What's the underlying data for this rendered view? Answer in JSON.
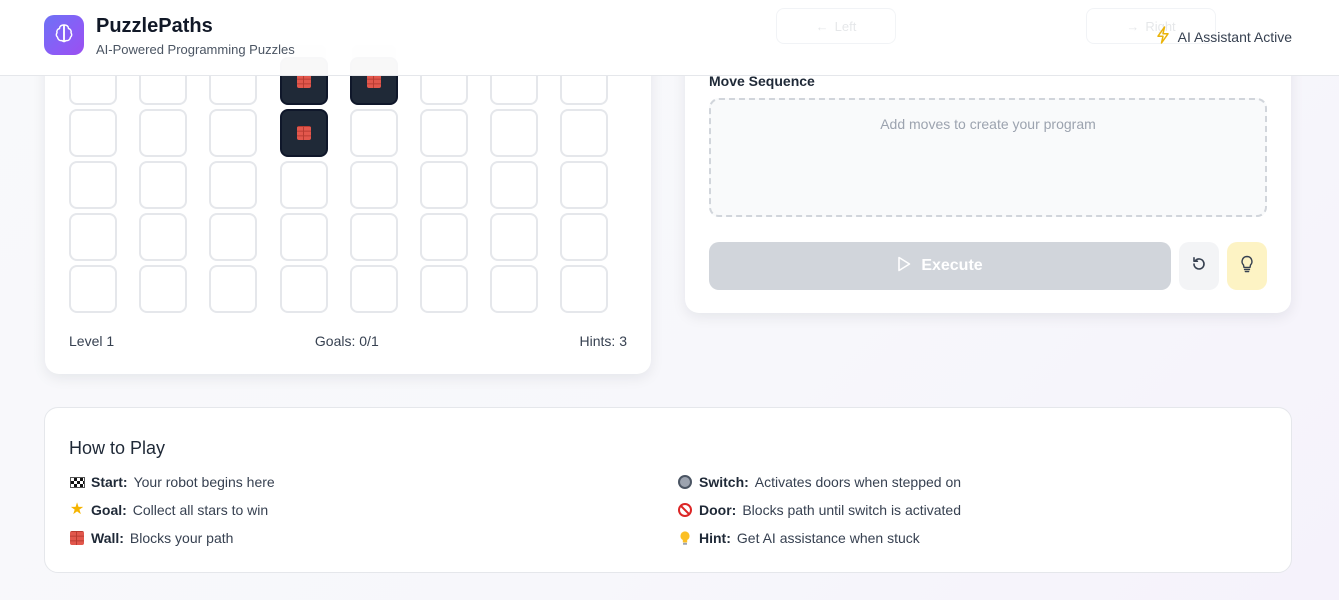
{
  "header": {
    "title": "PuzzlePaths",
    "subtitle": "AI-Powered Programming Puzzles",
    "ai_status": "AI Assistant Active",
    "ghost_controls": [
      "Left",
      "Right"
    ]
  },
  "board": {
    "rows": 5,
    "cols": 8,
    "walls": [
      [
        0,
        3
      ],
      [
        0,
        4
      ],
      [
        1,
        3
      ]
    ],
    "footer": {
      "level": "Level 1",
      "goals": "Goals: 0/1",
      "hints": "Hints: 3"
    }
  },
  "program": {
    "sequence_title": "Move Sequence",
    "empty_text": "Add moves to create your program",
    "execute_label": "Execute"
  },
  "howto": {
    "title": "How to Play",
    "items": [
      {
        "icon": "checkered-flag-icon",
        "label": "Start:",
        "desc": "Your robot begins here"
      },
      {
        "icon": "star-icon",
        "label": "Goal:",
        "desc": "Collect all stars to win"
      },
      {
        "icon": "brick-icon",
        "label": "Wall:",
        "desc": "Blocks your path"
      },
      {
        "icon": "switch-icon",
        "label": "Switch:",
        "desc": "Activates doors when stepped on"
      },
      {
        "icon": "no-entry-icon",
        "label": "Door:",
        "desc": "Blocks path until switch is activated"
      },
      {
        "icon": "lightbulb-icon",
        "label": "Hint:",
        "desc": "Get AI assistance when stuck"
      }
    ]
  },
  "colors": {
    "brand_gradient_start": "#6d72f5",
    "brand_gradient_end": "#9b4ff0",
    "wall": "#1f2937",
    "hint_button_bg": "#fdf3c4",
    "execute_disabled": "#d1d5db",
    "ai_bolt": "#eab308"
  }
}
